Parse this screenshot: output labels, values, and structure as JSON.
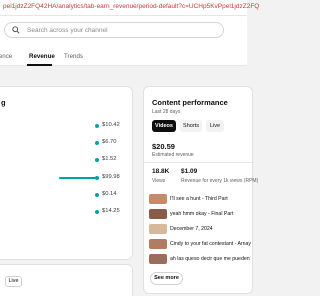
{
  "browser": {
    "url": "pel1jdzZ2FQ42HA/analytics/tab-earn_revenue/period-default?c=UCHp5KvPpel1jdzZ2FQ"
  },
  "search": {
    "placeholder": "Search across your channel"
  },
  "tabs": [
    {
      "label": "dience"
    },
    {
      "label": "Revenue",
      "selected": true
    },
    {
      "label": "Trends"
    }
  ],
  "revenue_card": {
    "title": "g",
    "rows": [
      {
        "value": "$10.42",
        "fraction": 0.03
      },
      {
        "value": "$6.70",
        "fraction": 0.02
      },
      {
        "value": "$1.52",
        "fraction": 0.01
      },
      {
        "value": "$99.98",
        "fraction": 1.0
      },
      {
        "value": "$0.14",
        "fraction": 0.01
      },
      {
        "value": "$14.25",
        "fraction": 0.04
      }
    ]
  },
  "lower_card": {
    "live_chip": "Live"
  },
  "content_performance": {
    "title": "Content performance",
    "subtitle": "Last 28 days",
    "chips": [
      "Videos",
      "Shorts",
      "Live"
    ],
    "estimated_revenue": "$20.59",
    "estimated_revenue_label": "Estimated revenue",
    "views_value": "18.8K",
    "views_label": "Views",
    "rpm_value": "$1.09",
    "rpm_label": "Revenue for every 1k views (RPM)",
    "videos": [
      {
        "title": "I'll see a hunt - Third Part",
        "thumb_color": "#c98a6a"
      },
      {
        "title": "yeah hmm okay - Final Part",
        "thumb_color": "#8a5a48"
      },
      {
        "title": "December 7, 2024",
        "thumb_color": "#d7b89a"
      },
      {
        "title": "Cindy to your fat contestant - Arnay",
        "thumb_color": "#b07c62"
      },
      {
        "title": "ah las queso decir que me pueden",
        "thumb_color": "#9c6d5c"
      }
    ],
    "see_more": "See more"
  },
  "colors": {
    "accent_teal": "#00a3a3",
    "chip_selected": "#0f0f0f"
  }
}
